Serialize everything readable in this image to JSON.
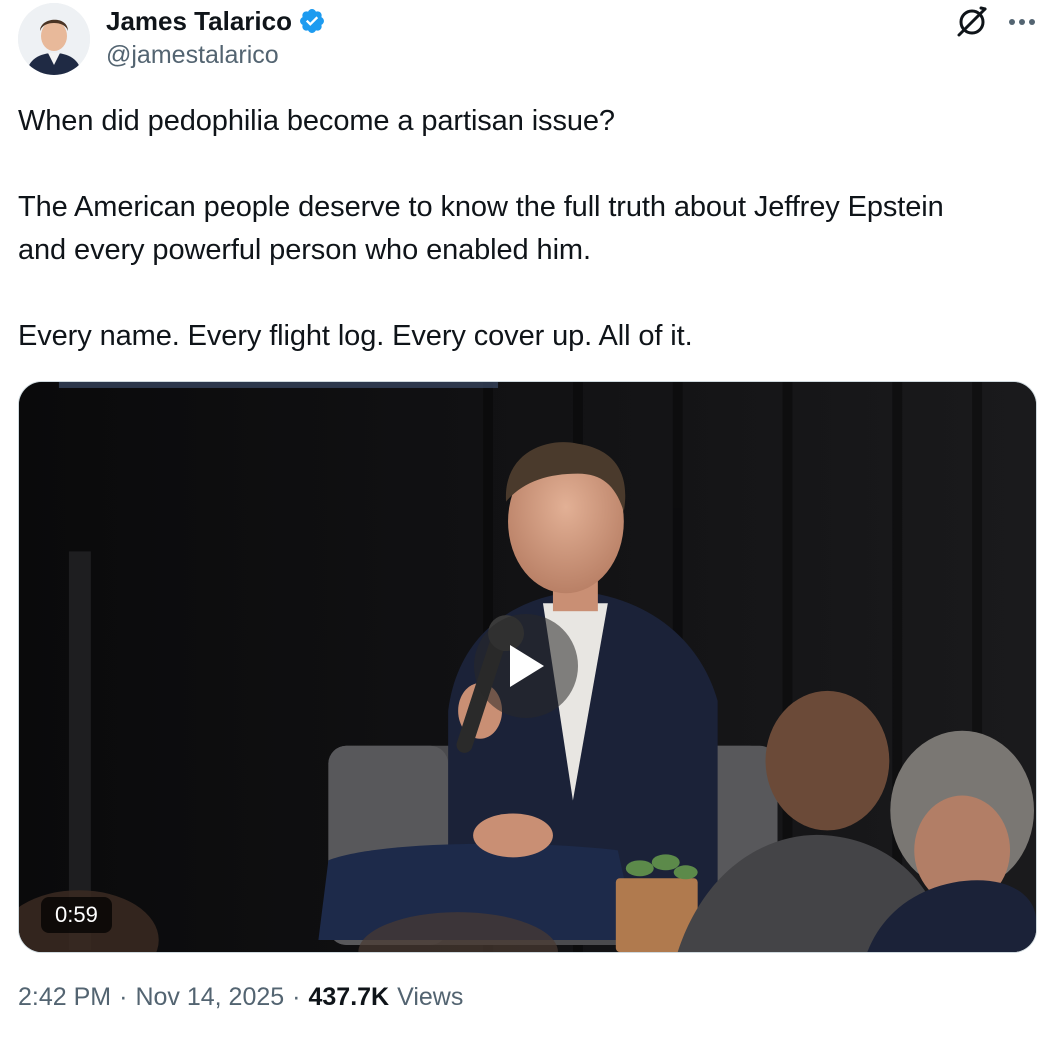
{
  "author": {
    "display_name": "James Talarico",
    "handle": "@jamestalarico",
    "verified": true,
    "verified_color": "#1d9bf0"
  },
  "header_actions": {
    "grok_icon": "grok-icon",
    "more_icon": "more-dots-icon"
  },
  "tweet": {
    "paragraphs": [
      "When did pedophilia become a partisan issue?",
      "The American people deserve to know the full truth about Jeffrey Epstein\nand every powerful person who enabled him.",
      "Every name. Every flight log. Every cover up. All of it."
    ]
  },
  "video": {
    "duration": "0:59",
    "play_icon": "play-icon"
  },
  "meta": {
    "time": "2:42 PM",
    "separator": "·",
    "date": "Nov 14, 2025",
    "views_count": "437.7K",
    "views_label": "Views"
  },
  "colors": {
    "text_primary": "#0f1419",
    "text_secondary": "#536471",
    "verified_blue": "#1d9bf0"
  }
}
